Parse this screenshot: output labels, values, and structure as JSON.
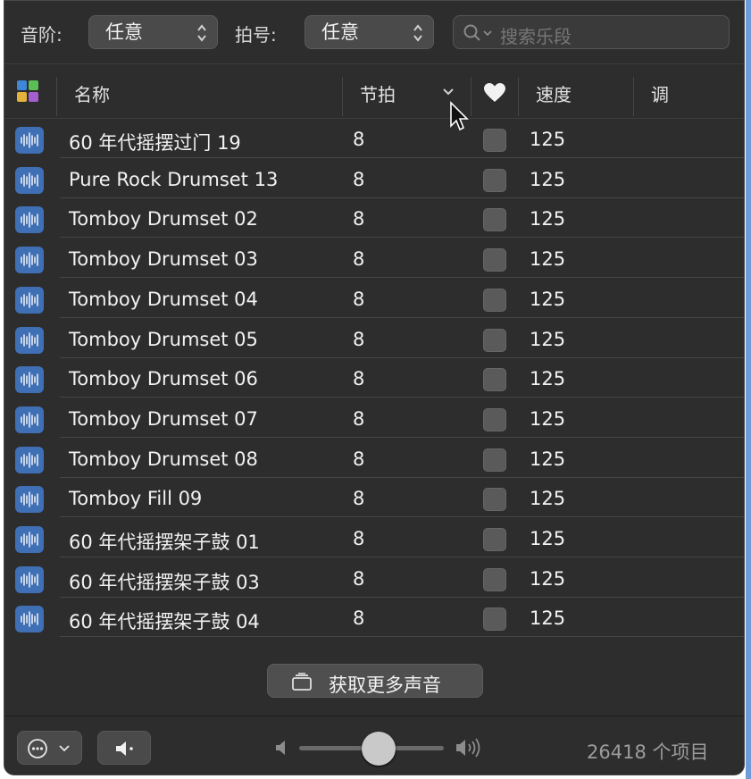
{
  "filters": {
    "scale_label": "音阶:",
    "scale_value": "任意",
    "time_label": "拍号:",
    "time_value": "任意",
    "search_placeholder": "搜索乐段"
  },
  "columns": {
    "name": "名称",
    "beats": "节拍",
    "tempo": "速度",
    "key": "调"
  },
  "rows": [
    {
      "name": "60 年代摇摆过门 19",
      "beats": "8",
      "tempo": "125"
    },
    {
      "name": "Pure Rock Drumset 13",
      "beats": "8",
      "tempo": "125"
    },
    {
      "name": "Tomboy Drumset 02",
      "beats": "8",
      "tempo": "125"
    },
    {
      "name": "Tomboy Drumset 03",
      "beats": "8",
      "tempo": "125"
    },
    {
      "name": "Tomboy Drumset 04",
      "beats": "8",
      "tempo": "125"
    },
    {
      "name": "Tomboy Drumset 05",
      "beats": "8",
      "tempo": "125"
    },
    {
      "name": "Tomboy Drumset 06",
      "beats": "8",
      "tempo": "125"
    },
    {
      "name": "Tomboy Drumset 07",
      "beats": "8",
      "tempo": "125"
    },
    {
      "name": "Tomboy Drumset 08",
      "beats": "8",
      "tempo": "125"
    },
    {
      "name": "Tomboy Fill 09",
      "beats": "8",
      "tempo": "125"
    },
    {
      "name": "60 年代摇摆架子鼓 01",
      "beats": "8",
      "tempo": "125"
    },
    {
      "name": "60 年代摇摆架子鼓 03",
      "beats": "8",
      "tempo": "125"
    },
    {
      "name": "60 年代摇摆架子鼓 04",
      "beats": "8",
      "tempo": "125"
    }
  ],
  "get_more_label": "获取更多声音",
  "footer": {
    "item_count": "26418 个项目",
    "volume_level": 0.55
  },
  "icons": {
    "color_filter": "color-grid-icon",
    "favorite": "heart-icon",
    "loop": "audio-waveform-icon",
    "search": "magnifier-icon",
    "more": "ellipsis-circle-icon",
    "preview": "speaker-icon"
  },
  "colors": {
    "panel_bg": "#2d2d2d",
    "loop_icon": "#3f6fb4",
    "window_edge": "#6f9bd6"
  }
}
